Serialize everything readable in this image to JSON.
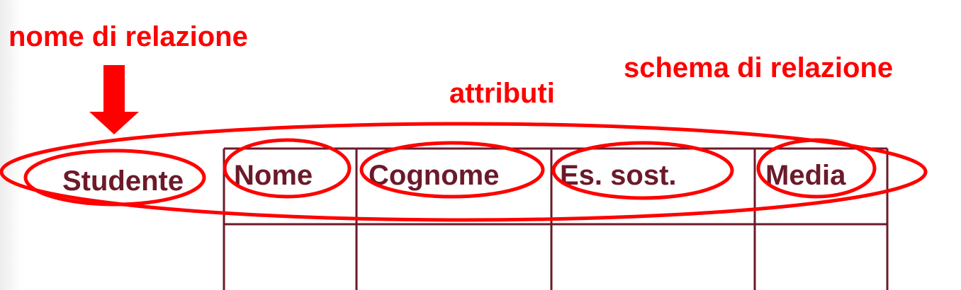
{
  "labels": {
    "relation_name_label": "nome di relazione",
    "relation_schema_label": "schema di relazione",
    "attributes_label": "attributi"
  },
  "relation": {
    "name": "Studente",
    "attributes": [
      "Nome",
      "Cognome",
      "Es. sost.",
      "Media"
    ]
  },
  "colors": {
    "annotation": "#ff0000",
    "table": "#6b1a2a"
  }
}
